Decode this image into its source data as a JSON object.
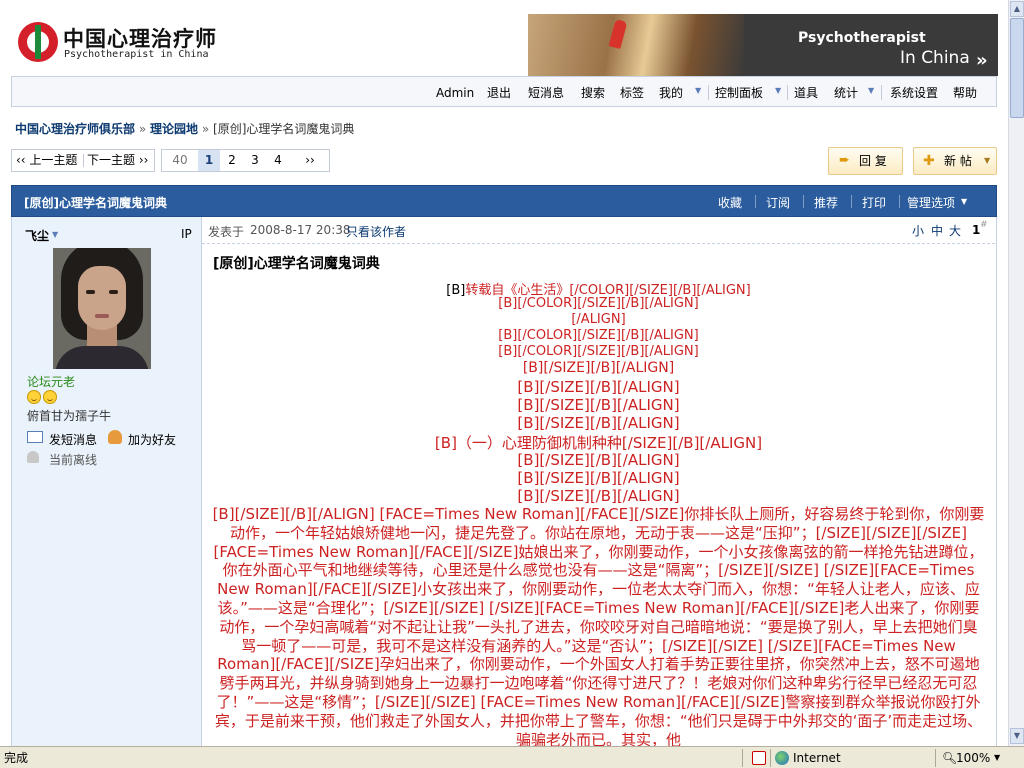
{
  "header": {
    "logo_cn": "中国心理治疗师",
    "logo_en": "Psychotherapist in China",
    "banner_line1": "Psychotherapist",
    "banner_line2": "In China"
  },
  "menu": {
    "items": [
      {
        "label": "Admin"
      },
      {
        "label": "退出"
      },
      {
        "label": "短消息"
      },
      {
        "label": "搜索"
      },
      {
        "label": "标签"
      },
      {
        "label": "我的"
      },
      {
        "label": "控制面板"
      },
      {
        "label": "道具"
      },
      {
        "label": "统计"
      },
      {
        "label": "系统设置"
      },
      {
        "label": "帮助"
      }
    ]
  },
  "breadcrumb": {
    "home": "中国心理治疗师俱乐部",
    "forum": "理论园地",
    "current": "[原创]心理学名词魔鬼词典",
    "sep": "»"
  },
  "topic_nav": {
    "prev": "‹‹ 上一主题",
    "next": "下一主题 ››"
  },
  "pager": {
    "total": "40",
    "pages": [
      "1",
      "2",
      "3",
      "4"
    ],
    "current": "1",
    "next": "››"
  },
  "buttons": {
    "reply": "回 复",
    "newpost": "新 帖"
  },
  "thread": {
    "title": "[原创]心理学名词魔鬼词典",
    "actions": [
      "收藏",
      "订阅",
      "推荐",
      "打印"
    ],
    "manage": "管理选项"
  },
  "author": {
    "name": "飞尘",
    "ip_label": "IP",
    "rank": "论坛元老",
    "signature": "俯首甘为孺子牛",
    "send_pm": "发短消息",
    "add_friend": "加为好友",
    "status": "当前离线"
  },
  "post": {
    "posted_at_label": "发表于",
    "posted_at": "2008-8-17 20:38",
    "only_author": "只看该作者",
    "font_sizes": [
      "小",
      "中",
      "大"
    ],
    "floor": "1",
    "floor_mark": "#",
    "heading": "[原创]心理学名词魔鬼词典",
    "lines": [
      {
        "b": "[B]",
        "t": "转载自《心生活》[/COLOR][/SIZE][/B][/ALIGN]"
      },
      {
        "t": "[B][/COLOR][/SIZE][/B][/ALIGN]"
      },
      {
        "t": "[/ALIGN]"
      },
      {
        "t": "[B][/COLOR][/SIZE][/B][/ALIGN]"
      },
      {
        "t": "[B][/COLOR][/SIZE][/B][/ALIGN]"
      },
      {
        "t": "[B][/SIZE][/B][/ALIGN]"
      },
      {
        "t": "[B][/SIZE][/B][/ALIGN]"
      },
      {
        "t": "[B][/SIZE][/B][/ALIGN]"
      },
      {
        "t": "[B][/SIZE][/B][/ALIGN]"
      },
      {
        "t": "[B]（一）心理防御机制种种[/SIZE][/B][/ALIGN]"
      },
      {
        "t": "[B][/SIZE][/B][/ALIGN]"
      },
      {
        "t": "[B][/SIZE][/B][/ALIGN]"
      },
      {
        "t": "[B][/SIZE][/B][/ALIGN]"
      }
    ],
    "paragraph": "[B][/SIZE][/B][/ALIGN] [FACE=Times New Roman][/FACE][/SIZE]你排长队上厕所，好容易终于轮到你，你刚要动作，一个年轻姑娘矫健地一闪，捷足先登了。你站在原地，无动于衷——这是“压抑”；[/SIZE][/SIZE][/SIZE][FACE=Times New Roman][/FACE][/SIZE]姑娘出来了，你刚要动作，一个小女孩像离弦的箭一样抢先钻进蹲位，你在外面心平气和地继续等待，心里还是什么感觉也没有——这是“隔离”；[/SIZE][/SIZE] [/SIZE][FACE=Times New Roman][/FACE][/SIZE]小女孩出来了，你刚要动作，一位老太太夺门而入，你想：“年轻人让老人，应该、应该。”——这是“合理化”；[/SIZE][/SIZE] [/SIZE][FACE=Times New Roman][/FACE][/SIZE]老人出来了，你刚要动作，一个孕妇高喊着“对不起让让我”一头扎了进去，你咬咬牙对自己暗暗地说：“要是换了别人，早上去把她们臭骂一顿了——可是，我可不是这样没有涵养的人。”这是“否认”；[/SIZE][/SIZE] [/SIZE][FACE=Times New Roman][/FACE][/SIZE]孕妇出来了，你刚要动作，一个外国女人打着手势正要往里挤，你突然冲上去，怒不可遏地劈手两耳光，并纵身骑到她身上一边暴打一边咆哮着“你还得寸进尺了？！老娘对你们这种卑劣行径早已经忍无可忍了！”——这是“移情”；[/SIZE][/SIZE] [FACE=Times New Roman][/FACE][/SIZE]警察接到群众举报说你殴打外宾，于是前来干预，他们救走了外国女人，并把你带上了警车，你想：“他们只是碍于中外邦交的‘面子’而走走过场、骗骗老外而已。其实，他"
  },
  "statusbar": {
    "left": "完成",
    "zone": "Internet",
    "zoom": "100%"
  }
}
